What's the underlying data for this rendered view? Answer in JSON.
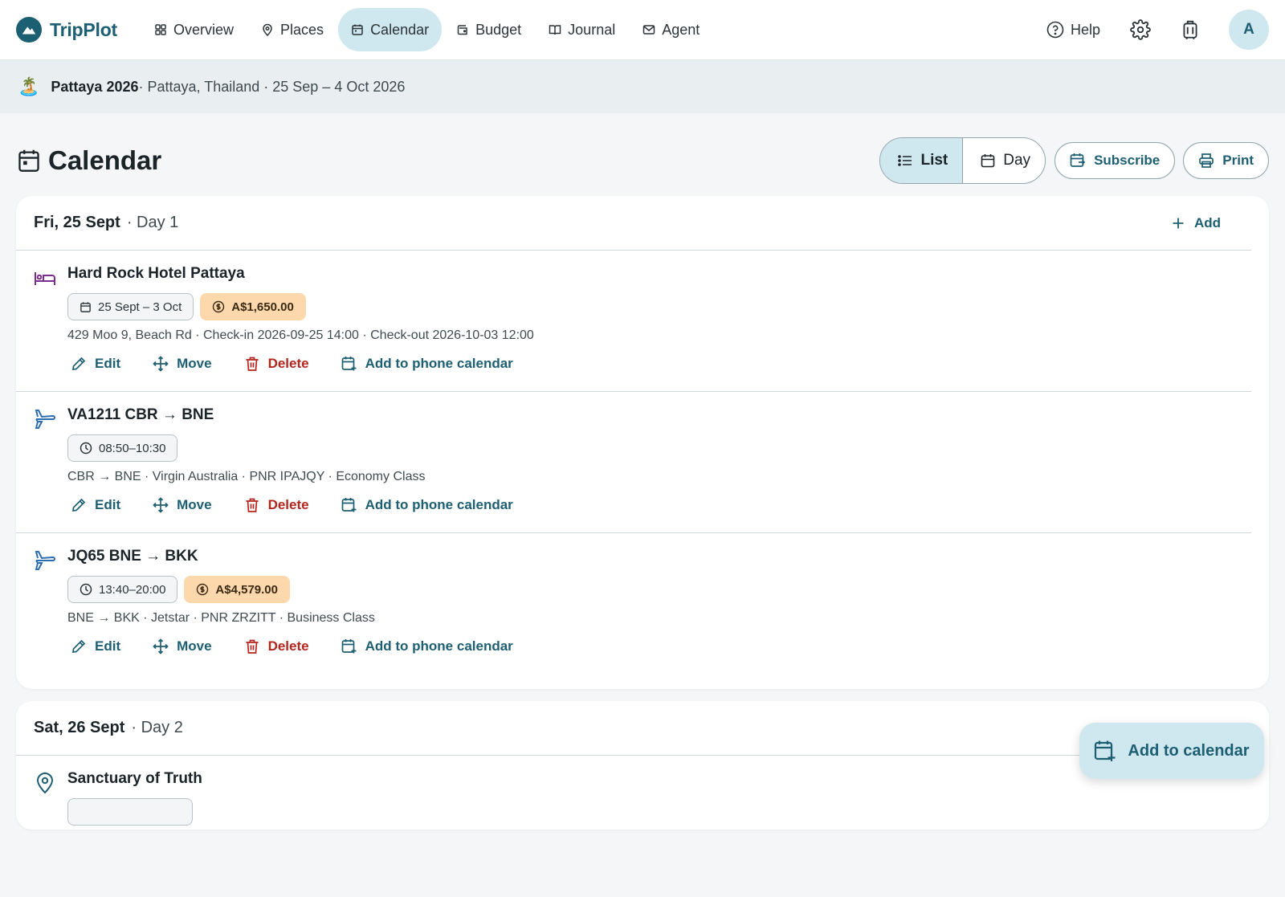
{
  "app": {
    "name": "TripPlot"
  },
  "nav": {
    "items": [
      {
        "label": "Overview",
        "icon": "grid-icon"
      },
      {
        "label": "Places",
        "icon": "map-pin-icon"
      },
      {
        "label": "Calendar",
        "icon": "calendar-icon",
        "active": true
      },
      {
        "label": "Budget",
        "icon": "wallet-icon"
      },
      {
        "label": "Journal",
        "icon": "book-icon"
      },
      {
        "label": "Agent",
        "icon": "mail-icon"
      }
    ],
    "help_label": "Help",
    "avatar_initial": "A"
  },
  "trip": {
    "emoji": "🏝️",
    "name": "Pattaya 2026",
    "details": " · Pattaya, Thailand · 25 Sep – 4 Oct 2026"
  },
  "page": {
    "title": "Calendar",
    "view_toggle": {
      "list_label": "List",
      "day_label": "Day",
      "active": "List"
    },
    "subscribe_label": "Subscribe",
    "print_label": "Print"
  },
  "days": [
    {
      "date": "Fri, 25 Sept",
      "day_label": "· Day 1",
      "add_label": "Add",
      "entries": [
        {
          "type": "hotel",
          "icon": "bed-icon",
          "title": "Hard Rock Hotel Pattaya",
          "time_chip": "25 Sept – 3 Oct",
          "time_chip_icon": "calendar-icon",
          "cost": "A$1,650.00",
          "detail": "429 Moo 9, Beach Rd · Check-in 2026-09-25 14:00 · Check-out 2026-10-03 12:00"
        },
        {
          "type": "flight",
          "icon": "plane-icon",
          "title": "VA1211 CBR → BNE",
          "time_chip": "08:50–10:30",
          "time_chip_icon": "clock-icon",
          "cost": "",
          "detail": "CBR → BNE · Virgin Australia · PNR IPAJQY · Economy Class"
        },
        {
          "type": "flight",
          "icon": "plane-icon",
          "title": "JQ65 BNE → BKK",
          "time_chip": "13:40–20:00",
          "time_chip_icon": "clock-icon",
          "cost": "A$4,579.00",
          "detail": "BNE → BKK · Jetstar · PNR ZRZITT · Business Class"
        }
      ]
    },
    {
      "date": "Sat, 26 Sept",
      "day_label": "· Day 2",
      "entries": [
        {
          "type": "place",
          "icon": "map-pin-icon",
          "title": "Sanctuary of Truth"
        }
      ]
    }
  ],
  "entry_actions": {
    "edit": "Edit",
    "move": "Move",
    "delete": "Delete",
    "add_to_phone": "Add to phone calendar"
  },
  "fab": {
    "label": "Add to calendar"
  },
  "colors": {
    "brand": "#1d5f72",
    "active_bg": "#cfe7ee",
    "danger": "#b3261e",
    "cost_chip": "#fdd8ad",
    "hotel_icon": "#7b2d8e",
    "flight_icon": "#2b6cb0"
  }
}
